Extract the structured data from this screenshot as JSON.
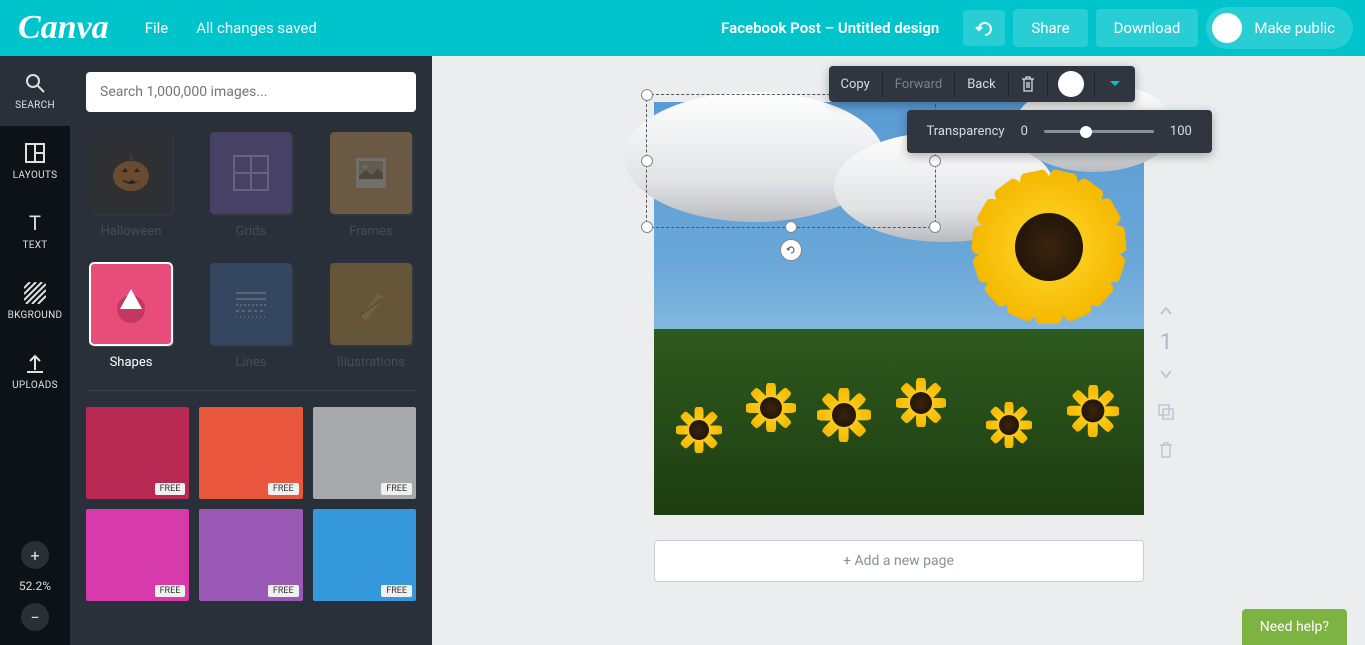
{
  "topbar": {
    "logo": "Canva",
    "file": "File",
    "save_status": "All changes saved",
    "doc_title": "Facebook Post – Untitled design",
    "share": "Share",
    "download": "Download",
    "make_public": "Make public"
  },
  "rail": {
    "items": [
      {
        "label": "SEARCH"
      },
      {
        "label": "LAYOUTS"
      },
      {
        "label": "TEXT"
      },
      {
        "label": "BKGROUND"
      },
      {
        "label": "UPLOADS"
      }
    ],
    "zoom": "52.2%"
  },
  "panel": {
    "search_placeholder": "Search 1,000,000 images...",
    "categories": [
      {
        "label": "Halloween"
      },
      {
        "label": "Grids"
      },
      {
        "label": "Frames"
      },
      {
        "label": "Shapes"
      },
      {
        "label": "Lines"
      },
      {
        "label": "Illustrations"
      }
    ],
    "badge": "FREE",
    "shapes": [
      {
        "color": "#b82a54"
      },
      {
        "color": "#e9573f"
      },
      {
        "color": "#a7a9ac"
      },
      {
        "color": "#d63aab"
      },
      {
        "color": "#9b59b6"
      },
      {
        "color": "#3498db"
      }
    ]
  },
  "context": {
    "copy": "Copy",
    "forward": "Forward",
    "back": "Back"
  },
  "transparency": {
    "label": "Transparency",
    "min": "0",
    "max": "100"
  },
  "canvas": {
    "add_page": "+ Add a new page",
    "page_num": "1"
  },
  "help": "Need help?"
}
